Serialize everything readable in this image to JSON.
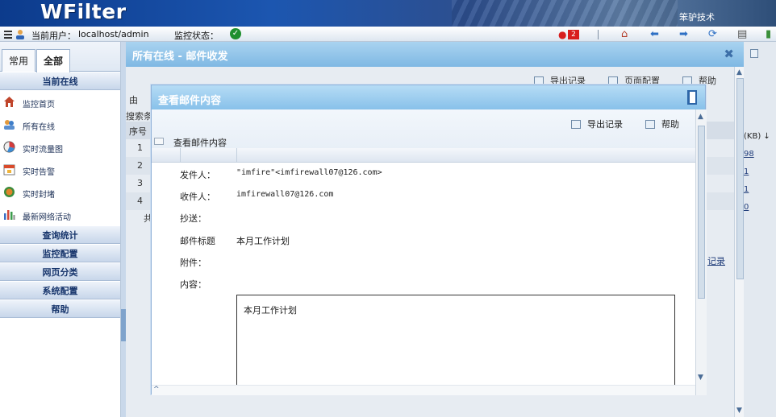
{
  "header": {
    "logo": "WFilter",
    "company": "笨驴技术"
  },
  "status": {
    "current_user_label": "当前用户：",
    "current_user": "localhost/admin",
    "monitor_status_label": "监控状态：",
    "alert_count": "2"
  },
  "sidebar": {
    "tabs": [
      {
        "label": "常用",
        "active": false
      },
      {
        "label": "全部",
        "active": true
      }
    ],
    "sections": [
      {
        "label": "当前在线"
      },
      {
        "label": "查询统计"
      },
      {
        "label": "监控配置"
      },
      {
        "label": "网页分类"
      },
      {
        "label": "系统配置"
      },
      {
        "label": "帮助"
      }
    ],
    "items": [
      {
        "label": "监控首页",
        "icon": "home-icon"
      },
      {
        "label": "所有在线",
        "icon": "users-icon"
      },
      {
        "label": "实时流量图",
        "icon": "pie-chart-icon"
      },
      {
        "label": "实时告警",
        "icon": "calendar-alarm-icon"
      },
      {
        "label": "实时封堵",
        "icon": "globe-block-icon"
      },
      {
        "label": "最新网络活动",
        "icon": "bar-chart-icon"
      }
    ]
  },
  "main": {
    "title": "所有在线 - 邮件收发",
    "toolbar": {
      "export": "导出记录",
      "page_config": "页面配置",
      "help": "帮助"
    },
    "background": {
      "search_label": "搜索条",
      "seq_header": "序号",
      "size_header": "(KB) ↓",
      "rows": [
        {
          "seq": "1",
          "size": "98"
        },
        {
          "seq": "2",
          "size": "1"
        },
        {
          "seq": "3",
          "size": "1"
        },
        {
          "seq": "4",
          "size": "0"
        }
      ],
      "total_prefix": "共",
      "records_link": "记录",
      "partial_char": "由"
    }
  },
  "modal": {
    "title": "查看邮件内容",
    "toolbar": {
      "export": "导出记录",
      "help": "帮助"
    },
    "subtitle": "查看邮件内容",
    "fields": {
      "from_label": "发件人：",
      "from_value": "\"imfire\"<imfirewall07@126.com>",
      "to_label": "收件人：",
      "to_value": "imfirewall07@126.com",
      "cc_label": "抄送：",
      "cc_value": "",
      "subject_label": "邮件标题",
      "subject_value": "本月工作计划",
      "attachments_label": "附件：",
      "attachments_value": "",
      "content_label": "内容：",
      "content_value": "本月工作计划"
    }
  }
}
